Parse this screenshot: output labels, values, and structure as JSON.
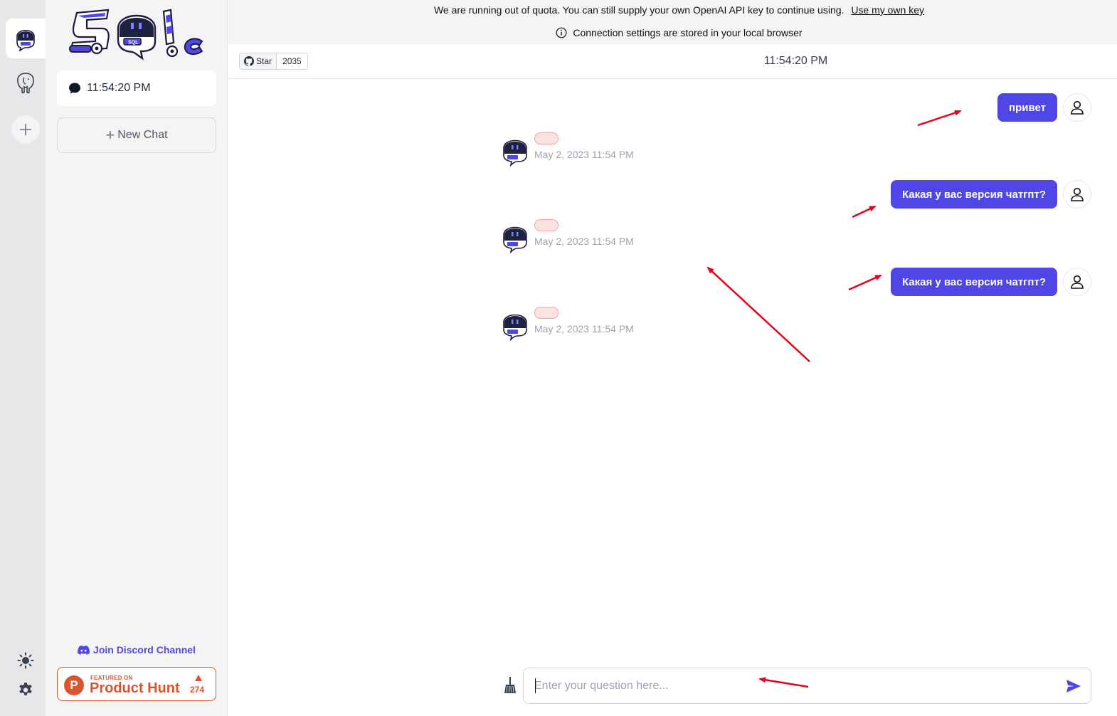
{
  "banner": {
    "quota_text": "We are running out of quota. You can still supply your own OpenAI API key to continue using.",
    "quota_link": "Use my own key",
    "settings_note": "Connection settings are stored in your local browser"
  },
  "sidebar": {
    "active_chat_title": "11:54:20 PM",
    "new_chat_label": "New Chat",
    "discord_label": "Join Discord Channel",
    "product_hunt": {
      "featured_on": "FEATURED ON",
      "name": "Product Hunt",
      "count": "274"
    }
  },
  "header": {
    "github_star_label": "Star",
    "github_star_count": "2035",
    "title": "11:54:20 PM"
  },
  "messages": [
    {
      "role": "user",
      "text": "привет"
    },
    {
      "role": "assistant",
      "text": "",
      "timestamp": "May 2, 2023 11:54 PM"
    },
    {
      "role": "user",
      "text": "Какая у вас версия чатгпт?"
    },
    {
      "role": "assistant",
      "text": "",
      "timestamp": "May 2, 2023 11:54 PM"
    },
    {
      "role": "user",
      "text": "Какая у вас версия чатгпт?"
    },
    {
      "role": "assistant",
      "text": "",
      "timestamp": "May 2, 2023 11:54 PM"
    }
  ],
  "input": {
    "placeholder": "Enter your question here...",
    "value": ""
  },
  "colors": {
    "accent": "#4f46e5",
    "annotation_arrow": "#e8001c",
    "product_hunt": "#da552f",
    "error_pill": "#fde2e2"
  }
}
